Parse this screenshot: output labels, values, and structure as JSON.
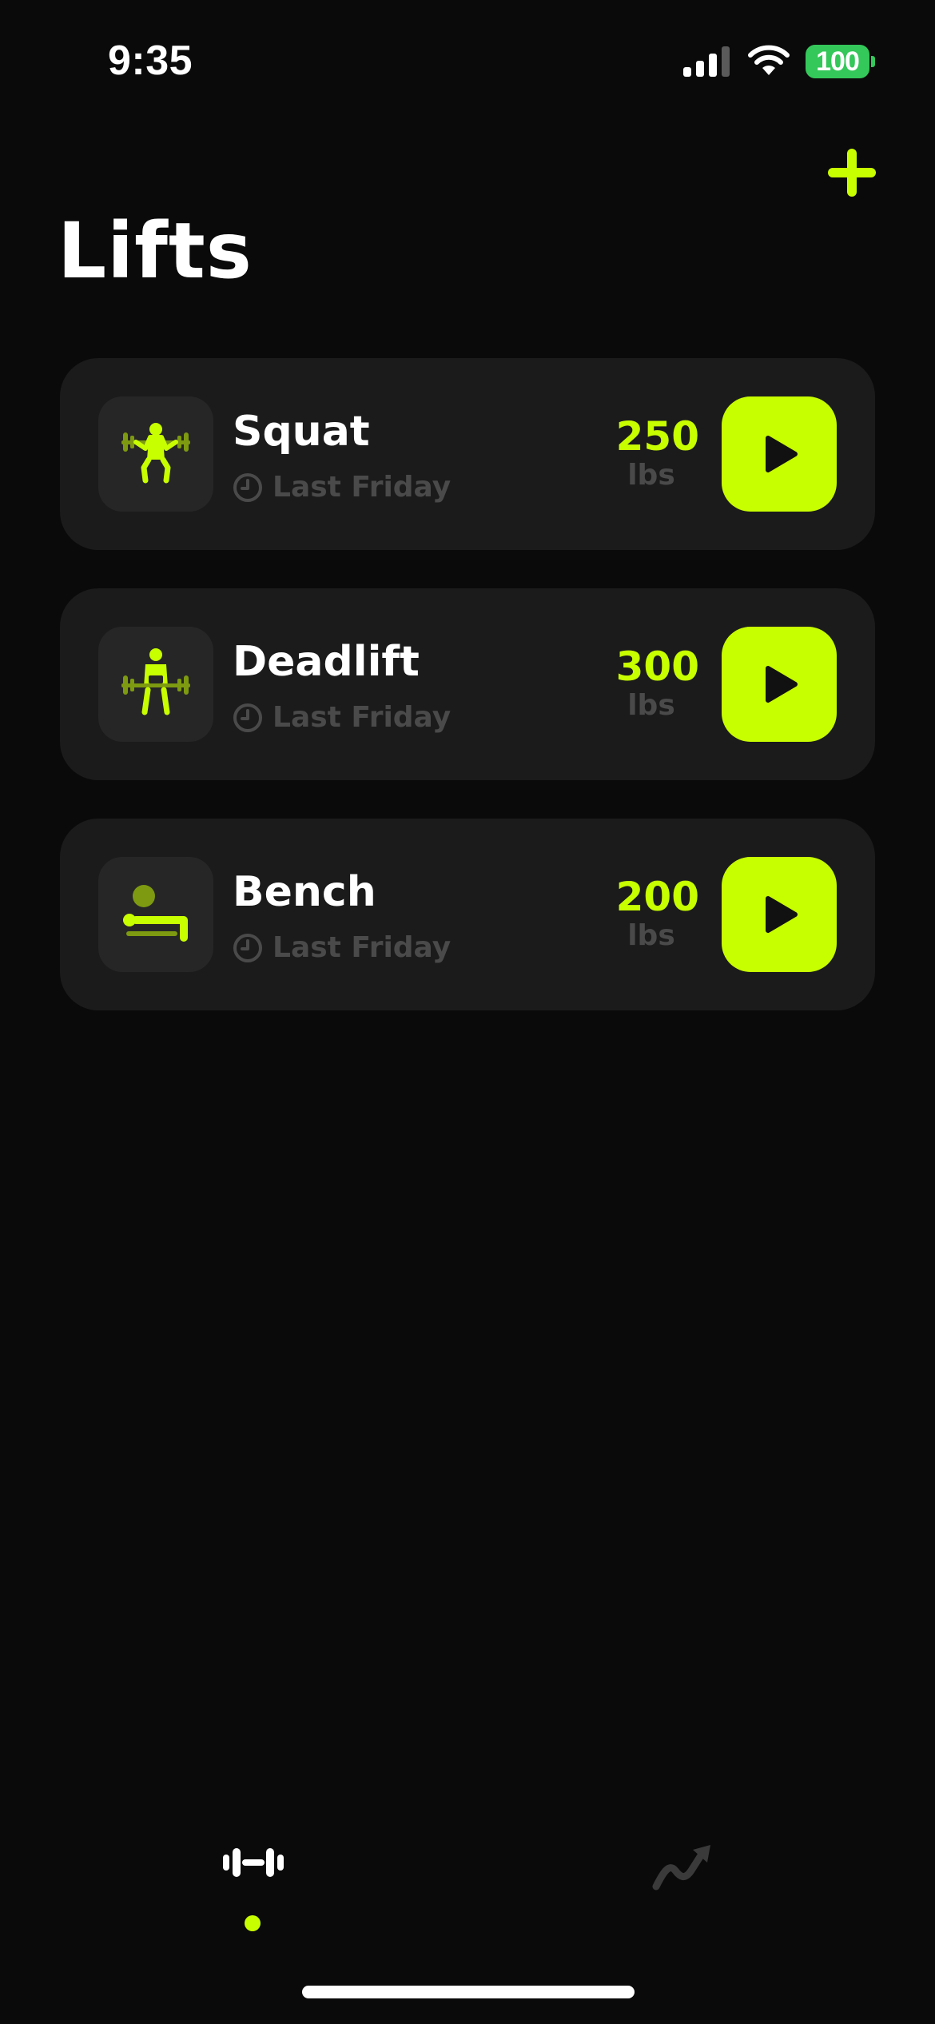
{
  "status_bar": {
    "time": "9:35",
    "battery": "100",
    "icons": [
      "signal-icon",
      "wifi-icon",
      "battery-icon"
    ]
  },
  "header": {
    "title": "Lifts",
    "add_icon": "plus-icon"
  },
  "lifts": [
    {
      "name": "Squat",
      "last": "Last Friday",
      "weight": "250",
      "unit": "lbs",
      "icon": "squat-icon"
    },
    {
      "name": "Deadlift",
      "last": "Last Friday",
      "weight": "300",
      "unit": "lbs",
      "icon": "deadlift-icon"
    },
    {
      "name": "Bench",
      "last": "Last Friday",
      "weight": "200",
      "unit": "lbs",
      "icon": "bench-icon"
    }
  ],
  "tab_bar": {
    "tabs": [
      {
        "icon": "dumbbell-icon",
        "active": true
      },
      {
        "icon": "trend-arrow-icon",
        "active": false
      }
    ]
  },
  "colors": {
    "background": "#0a0a0a",
    "card": "#1b1b1b",
    "icon_box": "#262626",
    "accent": "#c8ff00",
    "accent_dim": "#7d9a10",
    "muted_text": "#4a4a4a",
    "battery": "#34c759"
  }
}
